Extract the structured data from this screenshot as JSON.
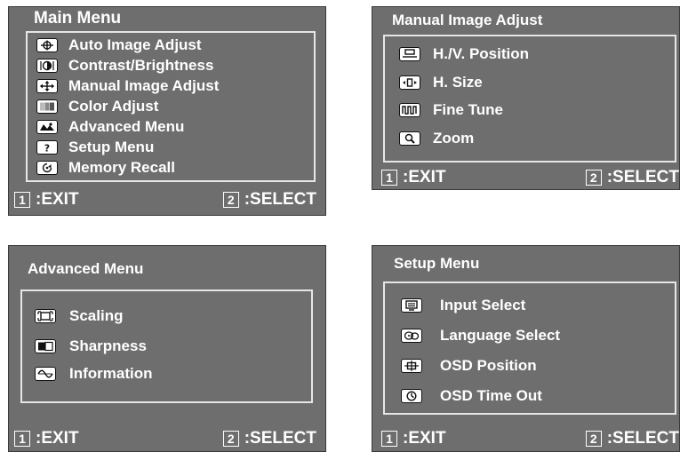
{
  "panels": {
    "main": {
      "title": "Main Menu",
      "items": [
        {
          "label": "Auto Image Adjust",
          "icon": "crosshair-icon"
        },
        {
          "label": "Contrast/Brightness",
          "icon": "contrast-icon"
        },
        {
          "label": "Manual Image Adjust",
          "icon": "move-arrows-icon"
        },
        {
          "label": "Color Adjust",
          "icon": "color-bars-icon"
        },
        {
          "label": "Advanced Menu",
          "icon": "advanced-icon"
        },
        {
          "label": "Setup Menu",
          "icon": "question-icon"
        },
        {
          "label": "Memory Recall",
          "icon": "memory-recall-icon"
        }
      ],
      "exit_num": "1",
      "exit_label": ":EXIT",
      "select_num": "2",
      "select_label": ":SELECT"
    },
    "manual": {
      "title": "Manual Image Adjust",
      "items": [
        {
          "label": "H./V. Position",
          "icon": "position-icon"
        },
        {
          "label": "H. Size",
          "icon": "h-size-icon"
        },
        {
          "label": "Fine Tune",
          "icon": "fine-tune-icon"
        },
        {
          "label": "Zoom",
          "icon": "zoom-icon"
        }
      ],
      "exit_num": "1",
      "exit_label": ":EXIT",
      "select_num": "2",
      "select_label": ":SELECT"
    },
    "advanced": {
      "title": "Advanced Menu",
      "items": [
        {
          "label": "Scaling",
          "icon": "scaling-icon"
        },
        {
          "label": "Sharpness",
          "icon": "sharpness-icon"
        },
        {
          "label": "Information",
          "icon": "information-icon"
        }
      ],
      "exit_num": "1",
      "exit_label": ":EXIT",
      "select_num": "2",
      "select_label": ":SELECT"
    },
    "setup": {
      "title": "Setup Menu",
      "items": [
        {
          "label": "Input Select",
          "icon": "input-select-icon"
        },
        {
          "label": "Language Select",
          "icon": "language-icon"
        },
        {
          "label": "OSD Position",
          "icon": "osd-position-icon"
        },
        {
          "label": "OSD Time Out",
          "icon": "clock-icon"
        }
      ],
      "exit_num": "1",
      "exit_label": ":EXIT",
      "select_num": "2",
      "select_label": ":SELECT"
    }
  }
}
